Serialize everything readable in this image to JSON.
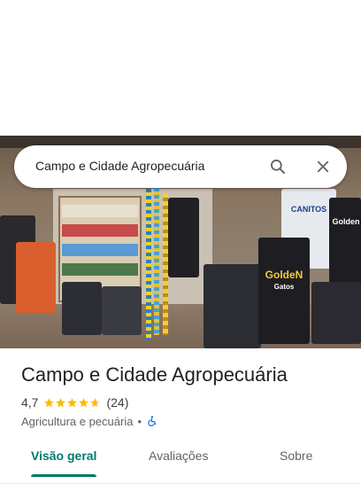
{
  "search": {
    "query": "Campo e Cidade Agropecuária",
    "search_icon": "search-icon",
    "close_icon": "close-icon"
  },
  "photo": {
    "description_icon": "store-photo",
    "signage": {
      "brand_1": "CANITOS",
      "brand_2": "Golden",
      "brand_3": "GoldeN",
      "brand_3_sub": "Gatos",
      "bag_label": "Golden"
    }
  },
  "place": {
    "name": "Campo e Cidade Agropecuária",
    "rating": "4,7",
    "rating_stars": 4.7,
    "review_count": "(24)",
    "category": "Agricultura e pecuária",
    "separator": "•",
    "accessibility_icon": "wheelchair-icon"
  },
  "tabs": [
    {
      "label": "Visão geral",
      "active": true
    },
    {
      "label": "Avaliações",
      "active": false
    },
    {
      "label": "Sobre",
      "active": false
    }
  ],
  "colors": {
    "accent": "#00796b",
    "star": "#fbbc04",
    "accessibility": "#1a73e8"
  }
}
